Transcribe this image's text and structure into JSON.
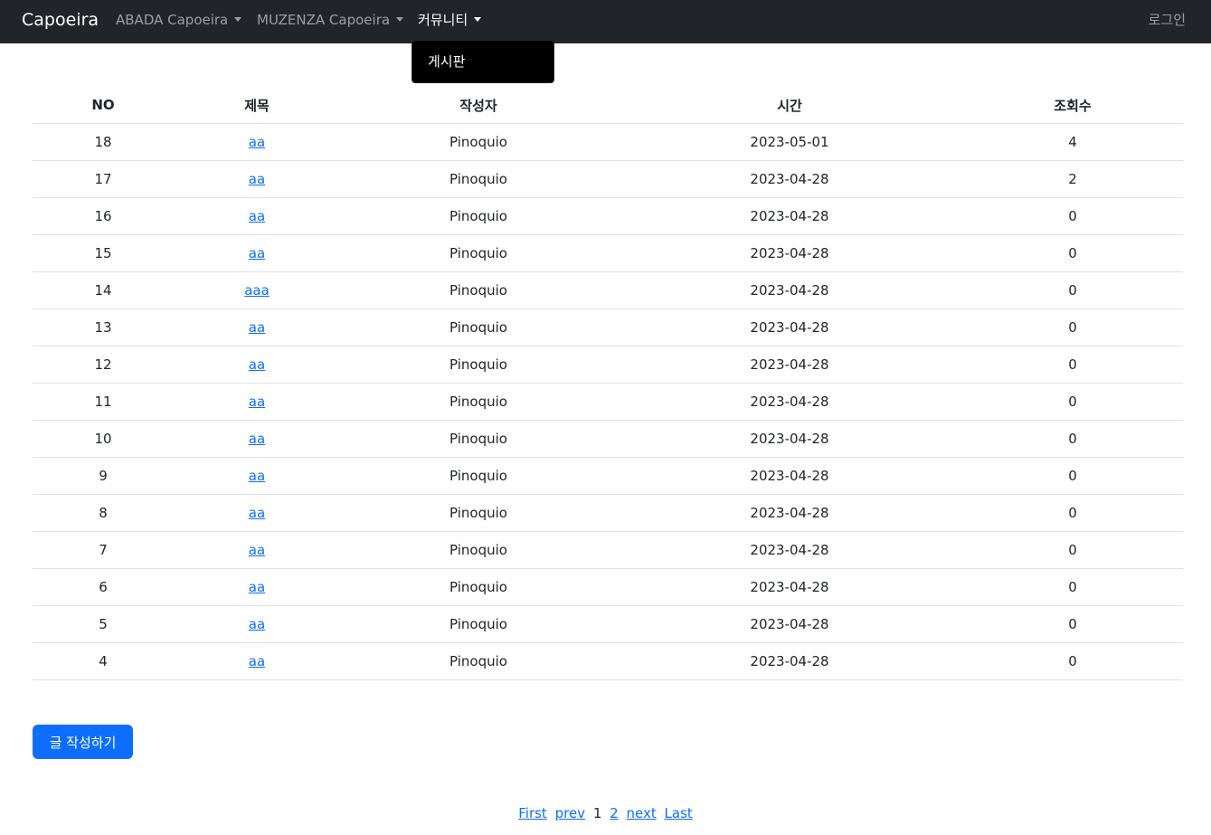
{
  "navbar": {
    "brand": "Capoeira",
    "items": [
      {
        "label": "ABADA Capoeira"
      },
      {
        "label": "MUZENZA Capoeira"
      },
      {
        "label": "커뮤니티"
      }
    ],
    "login": "로그인",
    "dropdown": {
      "item": "게시판"
    }
  },
  "table": {
    "headers": {
      "no": "NO",
      "title": "제목",
      "author": "작성자",
      "time": "시간",
      "views": "조회수"
    },
    "rows": [
      {
        "no": "18",
        "title": "aa",
        "author": "Pinoquio",
        "time": "2023-05-01",
        "views": "4"
      },
      {
        "no": "17",
        "title": "aa",
        "author": "Pinoquio",
        "time": "2023-04-28",
        "views": "2"
      },
      {
        "no": "16",
        "title": "aa",
        "author": "Pinoquio",
        "time": "2023-04-28",
        "views": "0"
      },
      {
        "no": "15",
        "title": "aa",
        "author": "Pinoquio",
        "time": "2023-04-28",
        "views": "0"
      },
      {
        "no": "14",
        "title": "aaa",
        "author": "Pinoquio",
        "time": "2023-04-28",
        "views": "0"
      },
      {
        "no": "13",
        "title": "aa",
        "author": "Pinoquio",
        "time": "2023-04-28",
        "views": "0"
      },
      {
        "no": "12",
        "title": "aa",
        "author": "Pinoquio",
        "time": "2023-04-28",
        "views": "0"
      },
      {
        "no": "11",
        "title": "aa",
        "author": "Pinoquio",
        "time": "2023-04-28",
        "views": "0"
      },
      {
        "no": "10",
        "title": "aa",
        "author": "Pinoquio",
        "time": "2023-04-28",
        "views": "0"
      },
      {
        "no": "9",
        "title": "aa",
        "author": "Pinoquio",
        "time": "2023-04-28",
        "views": "0"
      },
      {
        "no": "8",
        "title": "aa",
        "author": "Pinoquio",
        "time": "2023-04-28",
        "views": "0"
      },
      {
        "no": "7",
        "title": "aa",
        "author": "Pinoquio",
        "time": "2023-04-28",
        "views": "0"
      },
      {
        "no": "6",
        "title": "aa",
        "author": "Pinoquio",
        "time": "2023-04-28",
        "views": "0"
      },
      {
        "no": "5",
        "title": "aa",
        "author": "Pinoquio",
        "time": "2023-04-28",
        "views": "0"
      },
      {
        "no": "4",
        "title": "aa",
        "author": "Pinoquio",
        "time": "2023-04-28",
        "views": "0"
      }
    ]
  },
  "write_button": "글 작성하기",
  "pagination": {
    "first": "First",
    "prev": "prev",
    "current": "1",
    "page2": "2",
    "next": "next",
    "last": "Last"
  }
}
